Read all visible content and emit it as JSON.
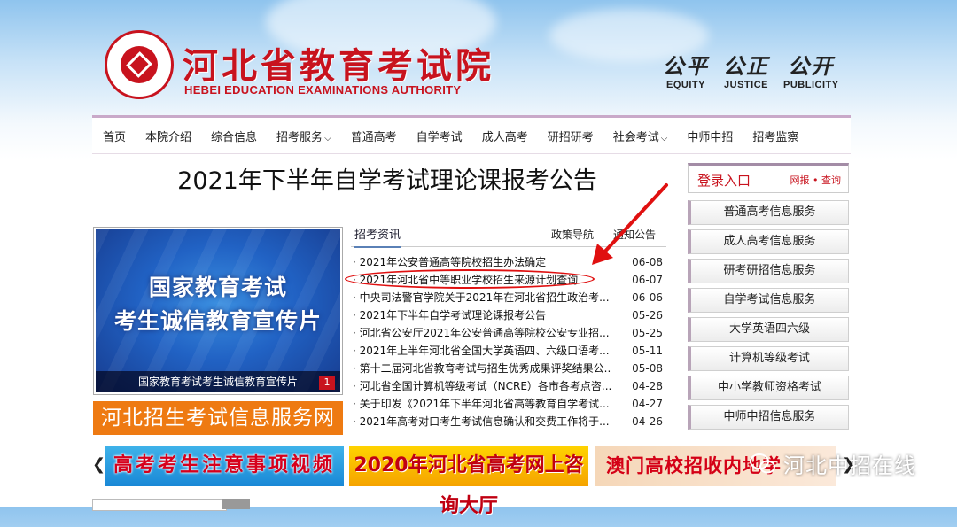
{
  "header": {
    "title": "河北省教育考试院",
    "subtitle": "HEBEI EDUCATION EXAMINATIONS AUTHORITY",
    "mottos": [
      {
        "cn": "公平",
        "en": "EQUITY"
      },
      {
        "cn": "公正",
        "en": "JUSTICE"
      },
      {
        "cn": "公开",
        "en": "PUBLICITY"
      }
    ],
    "brand_color": "#c8131e"
  },
  "nav": {
    "items": [
      {
        "label": "首页",
        "dropdown": false
      },
      {
        "label": "本院介绍",
        "dropdown": false
      },
      {
        "label": "综合信息",
        "dropdown": false
      },
      {
        "label": "招考服务",
        "dropdown": true
      },
      {
        "label": "普通高考",
        "dropdown": false
      },
      {
        "label": "自学考试",
        "dropdown": false
      },
      {
        "label": "成人高考",
        "dropdown": false
      },
      {
        "label": "研招研考",
        "dropdown": false
      },
      {
        "label": "社会考试",
        "dropdown": true
      },
      {
        "label": "中师中招",
        "dropdown": false
      },
      {
        "label": "招考监察",
        "dropdown": false
      }
    ],
    "caret_glyph": "⌵"
  },
  "main": {
    "page_title": "2021年下半年自学考试理论课报考公告"
  },
  "promo": {
    "line1": "国家教育考试",
    "line2": "考生诚信教育宣传片",
    "caption": "国家教育考试考生诚信教育宣传片",
    "page": "1"
  },
  "info_banner": "河北招生考试信息服务网",
  "news": {
    "tabs": [
      "招考资讯",
      "政策导航",
      "通知公告"
    ],
    "items": [
      {
        "title": "· 2021年公安普通高等院校招生办法确定",
        "date": "06-08"
      },
      {
        "title": "· 2021年河北省中等职业学校招生来源计划查询",
        "date": "06-07"
      },
      {
        "title": "· 中央司法警官学院关于2021年在河北省招生政治考...",
        "date": "06-06"
      },
      {
        "title": "· 2021年下半年自学考试理论课报考公告",
        "date": "05-26"
      },
      {
        "title": "· 河北省公安厅2021年公安普通高等院校公安专业招...",
        "date": "05-25"
      },
      {
        "title": "· 2021年上半年河北省全国大学英语四、六级口语考...",
        "date": "05-11"
      },
      {
        "title": "· 第十二届河北省教育考试与招生优秀成果评奖结果公...",
        "date": "05-08"
      },
      {
        "title": "· 河北省全国计算机等级考试（NCRE）各市各考点咨...",
        "date": "04-28"
      },
      {
        "title": "· 关于印发《2021年下半年河北省高等教育自学考试...",
        "date": "04-27"
      },
      {
        "title": "· 2021年高考对口考生考试信息确认和交费工作将于...",
        "date": "04-26"
      }
    ]
  },
  "sidebar": {
    "login_title": "登录入口",
    "login_links": "网报 • 查询",
    "services": [
      "普通高考信息服务",
      "成人高考信息服务",
      "研考研招信息服务",
      "自学考试信息服务",
      "大学英语四六级",
      "计算机等级考试",
      "中小学教师资格考试",
      "中师中招信息服务"
    ]
  },
  "bottom_banners": {
    "prev": "❮",
    "next": "❯",
    "items": [
      "高考考生注意事项视频",
      "2020年河北省高考网上咨询大厅",
      "澳门高校招收内地学"
    ]
  },
  "watermark": "河北中招在线",
  "icons": [
    "logo-seal-icon",
    "chevron-down-icon",
    "arrow-annotation-icon",
    "wechat-icon"
  ],
  "annotation_color": "#e01010"
}
